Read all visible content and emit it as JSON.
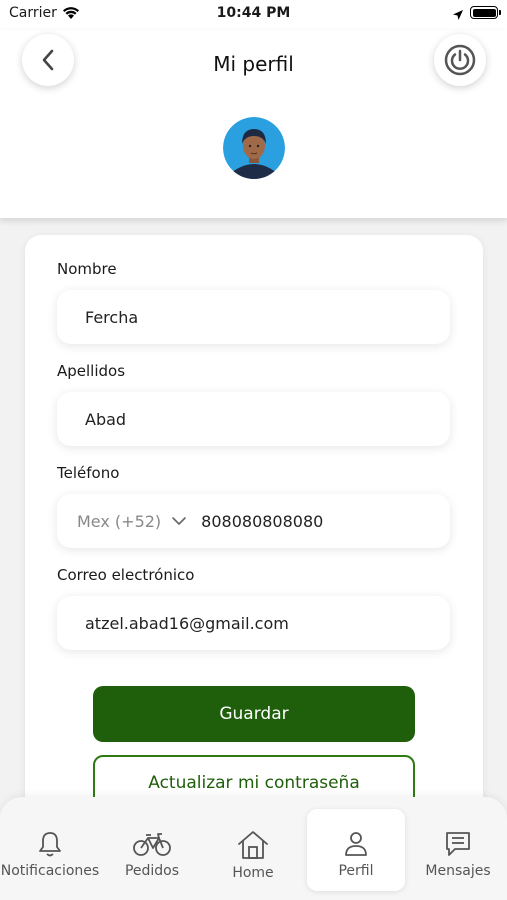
{
  "status_bar": {
    "carrier": "Carrier",
    "time": "10:44 PM"
  },
  "header": {
    "title": "Mi perfil",
    "back_icon": "chevron-left-icon",
    "power_icon": "power-icon"
  },
  "form": {
    "nombre": {
      "label": "Nombre",
      "value": "Fercha"
    },
    "apellidos": {
      "label": "Apellidos",
      "value": "Abad"
    },
    "telefono": {
      "label": "Teléfono",
      "country_code": "Mex (+52)",
      "value": "808080808080"
    },
    "correo": {
      "label": "Correo electrónico",
      "value": "atzel.abad16@gmail.com"
    }
  },
  "buttons": {
    "save": "Guardar",
    "update_password": "Actualizar mi contraseña"
  },
  "nav": {
    "items": [
      {
        "label": "Notificaciones",
        "icon": "bell-icon",
        "active": false
      },
      {
        "label": "Pedidos",
        "icon": "bicycle-icon",
        "active": false
      },
      {
        "label": "Home",
        "icon": "home-icon",
        "active": false
      },
      {
        "label": "Perfil",
        "icon": "user-icon",
        "active": true
      },
      {
        "label": "Mensajes",
        "icon": "message-icon",
        "active": false
      }
    ]
  },
  "colors": {
    "primary": "#1f5e0b",
    "outline": "#2f7a14",
    "background": "#f2f2f2"
  }
}
